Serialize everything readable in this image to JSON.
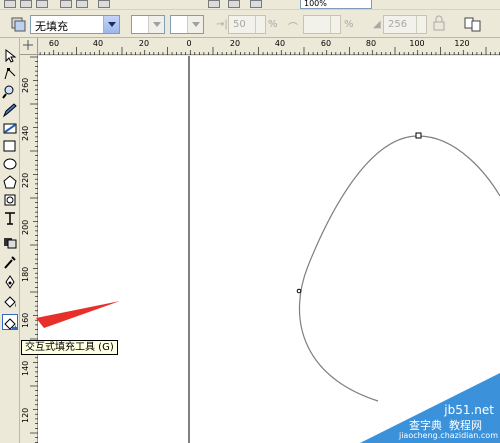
{
  "property_bar": {
    "fill_type_value": "无填充",
    "angle_value": "50",
    "percent_unit": "%",
    "transparency_value": "256",
    "zoom_value": "100%"
  },
  "h_ruler": {
    "labels": [
      "60",
      "40",
      "20",
      "0",
      "20",
      "40",
      "60",
      "80",
      "100",
      "120"
    ]
  },
  "v_ruler": {
    "labels": [
      "260",
      "240",
      "220",
      "200",
      "180",
      "160",
      "140",
      "120"
    ]
  },
  "tooltip": {
    "text": "交互式填充工具 (G)"
  },
  "watermark": {
    "site": "jb51.net",
    "brand": "查字典",
    "section": "教程网",
    "url": "jiaocheng.chazidian.com"
  },
  "colors": {
    "ui_bg": "#ece9d8",
    "arrow_red": "#e8302a",
    "tooltip_bg": "#ffffe1",
    "curve": "#7f7f7f"
  }
}
